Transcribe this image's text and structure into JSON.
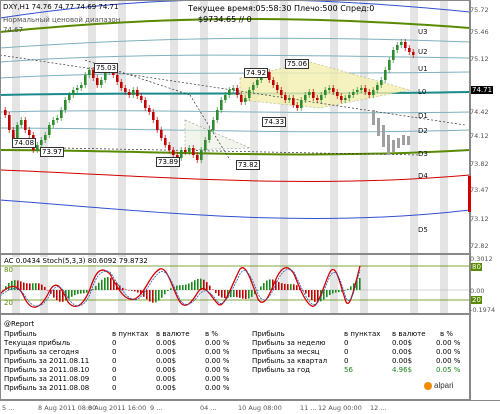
{
  "header": {
    "symbol_line": "DXY,H1  74.76 74.77 74.69 74.71",
    "normal_range_label": "Нормальный ценовой диапазон",
    "range_value": "74.67",
    "timer_label": "Текущее время:05:58:30 Плечо:500 Спред:0",
    "balance": "$9734.65 // 0"
  },
  "price_axis": {
    "ticks": [
      "75.72",
      "75.46",
      "75.12",
      "74.71",
      "74.42",
      "74.12",
      "73.82",
      "73.47",
      "73.12",
      "72.82"
    ],
    "current_price": "74.71"
  },
  "zones": [
    "U3",
    "U2",
    "U1",
    "L0",
    "D1",
    "D2",
    "D3",
    "D4",
    "D5"
  ],
  "price_tags": [
    "75.03",
    "74.08",
    "73.97",
    "73.89",
    "73.82",
    "74.33",
    "74.92",
    "75.06"
  ],
  "indicator": {
    "label": "AC 0.0434  Stoch(5,3,3) 80.6092 79.8732",
    "ticks": [
      "0.3012",
      "80",
      "20",
      "0.00",
      "-0.1974"
    ],
    "levels": [
      "80",
      "20"
    ]
  },
  "report": {
    "title": "@Report",
    "headers_left": [
      "Прибыль",
      "в пунктах",
      "в валюте",
      "в %"
    ],
    "rows_left": [
      [
        "Текущая прибыль",
        "0",
        "0.00$",
        "0.00 %"
      ],
      [
        "Прибыль за сегодня",
        "0",
        "0.00$",
        "0.00 %"
      ],
      [
        "Прибыль за 2011.08.11",
        "0",
        "0.00$",
        "0.00 %"
      ],
      [
        "Прибыль за 2011.08.10",
        "0",
        "0.00$",
        "0.00 %"
      ],
      [
        "Прибыль за 2011.08.09",
        "0",
        "0.00$",
        "0.00 %"
      ],
      [
        "Прибыль за 2011.08.08",
        "0",
        "0.00$",
        "0.00 %"
      ]
    ],
    "headers_right": [
      "Прибыль",
      "в пунктах",
      "в валюте",
      "в %"
    ],
    "rows_right": [
      [
        "Прибыль за неделю",
        "0",
        "0.00$",
        "0.00 %"
      ],
      [
        "Прибыль за месяц",
        "0",
        "0.00$",
        "0.00 %"
      ],
      [
        "Прибыль за квартал",
        "0",
        "0.00$",
        "0.00 %"
      ],
      [
        "Прибыль за год",
        "56",
        "4.96$",
        "0.05 %"
      ]
    ],
    "brand": "alpari"
  },
  "time_axis": [
    "5 ...",
    "8 Aug 2011 08:00",
    "8 Aug 2011 16:00",
    "9 ...",
    "04 ...",
    "10 Aug 08:00",
    "11 ...",
    "12 Aug 00:00",
    "12 ..."
  ],
  "colors": {
    "candle_up": "#2e8b2e",
    "candle_down": "#c00000",
    "channel_green": "#5a8a00",
    "channel_teal": "#1a8a8a",
    "channel_red": "#d40000",
    "channel_blue": "#3050d0",
    "stoch_main": "#d40000",
    "ac_up": "#1a8a1a",
    "ac_down": "#c00000"
  }
}
